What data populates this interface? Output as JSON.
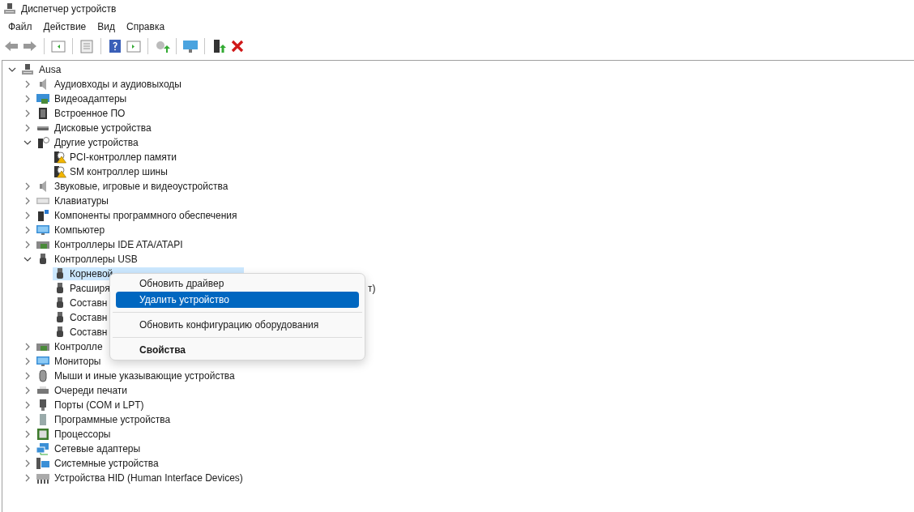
{
  "window": {
    "title": "Диспетчер устройств"
  },
  "menu": [
    "Файл",
    "Действие",
    "Вид",
    "Справка"
  ],
  "tree": {
    "label": "Ausa",
    "kind": "computer-root",
    "expanded": true,
    "children": [
      {
        "label": "Аудиовходы и аудиовыходы",
        "kind": "audio",
        "expanded": false
      },
      {
        "label": "Видеоадаптеры",
        "kind": "display",
        "expanded": false
      },
      {
        "label": "Встроенное ПО",
        "kind": "chip",
        "expanded": false
      },
      {
        "label": "Дисковые устройства",
        "kind": "disk",
        "expanded": false
      },
      {
        "label": "Другие устройства",
        "kind": "unknown",
        "expanded": true,
        "children": [
          {
            "label": "PCI-контроллер памяти",
            "kind": "warning",
            "selected": false
          },
          {
            "label": "SM контроллер шины",
            "kind": "warning",
            "selected": false
          }
        ]
      },
      {
        "label": "Звуковые, игровые и видеоустройства",
        "kind": "audio",
        "expanded": false
      },
      {
        "label": "Клавиатуры",
        "kind": "keyboard",
        "expanded": false
      },
      {
        "label": "Компоненты программного обеспечения",
        "kind": "software",
        "expanded": false
      },
      {
        "label": "Компьютер",
        "kind": "monitor",
        "expanded": false
      },
      {
        "label": "Контроллеры IDE ATA/ATAPI",
        "kind": "card",
        "expanded": false
      },
      {
        "label": "Контроллеры USB",
        "kind": "usb",
        "expanded": true,
        "children": [
          {
            "label": "Корневой",
            "kind": "usb",
            "selected": true
          },
          {
            "label": "Расширя",
            "tail": "т)",
            "kind": "usb",
            "selected": false
          },
          {
            "label": "Составн",
            "kind": "usb",
            "selected": false
          },
          {
            "label": "Составн",
            "kind": "usb",
            "selected": false
          },
          {
            "label": "Составн",
            "kind": "usb",
            "selected": false
          }
        ]
      },
      {
        "label": "Контролле",
        "kind": "card",
        "expanded": false
      },
      {
        "label": "Мониторы",
        "kind": "monitor",
        "expanded": false
      },
      {
        "label": "Мыши и иные указывающие устройства",
        "kind": "mouse",
        "expanded": false
      },
      {
        "label": "Очереди печати",
        "kind": "printer",
        "expanded": false
      },
      {
        "label": "Порты (COM и LPT)",
        "kind": "port",
        "expanded": false
      },
      {
        "label": "Программные устройства",
        "kind": "tower",
        "expanded": false
      },
      {
        "label": "Процессоры",
        "kind": "cpu",
        "expanded": false
      },
      {
        "label": "Сетевые адаптеры",
        "kind": "network",
        "expanded": false
      },
      {
        "label": "Системные устройства",
        "kind": "system",
        "expanded": false
      },
      {
        "label": "Устройства HID (Human Interface Devices)",
        "kind": "hid",
        "expanded": false
      }
    ]
  },
  "context_menu": [
    {
      "kind": "item",
      "label": "Обновить драйвер",
      "selected": false
    },
    {
      "kind": "item",
      "label": "Удалить устройство",
      "selected": true
    },
    {
      "kind": "separator"
    },
    {
      "kind": "item",
      "label": "Обновить конфигурацию оборудования",
      "selected": false
    },
    {
      "kind": "separator"
    },
    {
      "kind": "default",
      "label": "Свойства",
      "selected": false
    }
  ]
}
